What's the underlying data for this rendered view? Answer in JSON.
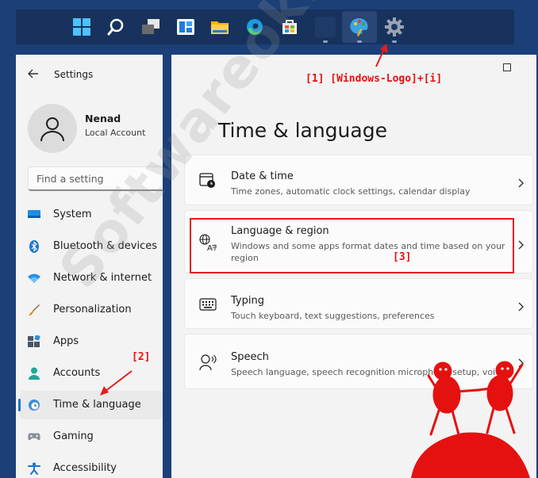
{
  "taskbar": {
    "icons": [
      "start-icon",
      "search-icon",
      "task-view-icon",
      "widgets-icon",
      "file-explorer-icon",
      "edge-icon",
      "store-icon",
      "blank-app-icon",
      "paint-app-icon",
      "settings-icon"
    ]
  },
  "window": {
    "app_title": "Settings",
    "user": {
      "name": "Nenad",
      "account_type": "Local Account"
    },
    "search": {
      "placeholder": "Find a setting"
    },
    "nav": [
      {
        "label": "System",
        "icon": "system-icon"
      },
      {
        "label": "Bluetooth & devices",
        "icon": "bluetooth-icon"
      },
      {
        "label": "Network & internet",
        "icon": "wifi-icon"
      },
      {
        "label": "Personalization",
        "icon": "brush-icon"
      },
      {
        "label": "Apps",
        "icon": "apps-icon"
      },
      {
        "label": "Accounts",
        "icon": "accounts-icon"
      },
      {
        "label": "Time & language",
        "icon": "globe-clock-icon",
        "selected": true
      },
      {
        "label": "Gaming",
        "icon": "gamepad-icon"
      },
      {
        "label": "Accessibility",
        "icon": "accessibility-icon"
      }
    ],
    "page_title": "Time & language",
    "cards": [
      {
        "title": "Date & time",
        "description": "Time zones, automatic clock settings, calendar display",
        "icon": "calendar-clock-icon"
      },
      {
        "title": "Language & region",
        "description": "Windows and some apps format dates and time based on your region",
        "icon": "language-icon"
      },
      {
        "title": "Typing",
        "description": "Touch keyboard, text suggestions, preferences",
        "icon": "keyboard-icon"
      },
      {
        "title": "Speech",
        "description": "Speech language, speech recognition microphone setup, voi",
        "icon": "speech-icon"
      }
    ]
  },
  "annotations": {
    "step1": "[1] [Windows-Logo]+[i]",
    "step2": "[2]",
    "step3": "[3]",
    "watermark": "Softwareok.com",
    "accent_color": "#e51b1b"
  }
}
